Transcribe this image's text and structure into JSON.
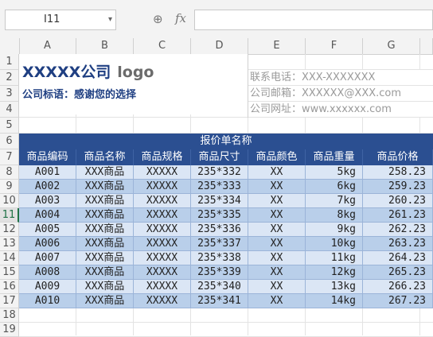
{
  "formula_bar": {
    "name_box": "I11",
    "zoom_icon": "zoom-icon",
    "fx_label": "fx",
    "formula": ""
  },
  "columns": [
    "A",
    "B",
    "C",
    "D",
    "E",
    "F",
    "G"
  ],
  "rows": [
    "1",
    "2",
    "3",
    "4",
    "5",
    "6",
    "7",
    "8",
    "9",
    "10",
    "11",
    "12",
    "13",
    "14",
    "15",
    "16",
    "17",
    "18",
    "19"
  ],
  "active_row": "11",
  "header": {
    "company_name": "XXXXX公司",
    "logo_text": "logo",
    "slogan": "公司标语：感谢您的选择",
    "phone": "联系电话：XXX-XXXXXXX",
    "email": "公司邮箱：XXXXXX@XXX.com",
    "website": "公司网址：www.xxxxxx.com"
  },
  "table": {
    "title": "报价单名称",
    "columns": [
      "商品编码",
      "商品名称",
      "商品规格",
      "商品尺寸",
      "商品颜色",
      "商品重量",
      "商品价格"
    ],
    "rows": [
      [
        "A001",
        "XXX商品",
        "XXXXX",
        "235*332",
        "XX",
        "5kg",
        "258.23"
      ],
      [
        "A002",
        "XXX商品",
        "XXXXX",
        "235*333",
        "XX",
        "6kg",
        "259.23"
      ],
      [
        "A003",
        "XXX商品",
        "XXXXX",
        "235*334",
        "XX",
        "7kg",
        "260.23"
      ],
      [
        "A004",
        "XXX商品",
        "XXXXX",
        "235*335",
        "XX",
        "8kg",
        "261.23"
      ],
      [
        "A005",
        "XXX商品",
        "XXXXX",
        "235*336",
        "XX",
        "9kg",
        "262.23"
      ],
      [
        "A006",
        "XXX商品",
        "XXXXX",
        "235*337",
        "XX",
        "10kg",
        "263.23"
      ],
      [
        "A007",
        "XXX商品",
        "XXXXX",
        "235*338",
        "XX",
        "11kg",
        "264.23"
      ],
      [
        "A008",
        "XXX商品",
        "XXXXX",
        "235*339",
        "XX",
        "12kg",
        "265.23"
      ],
      [
        "A009",
        "XXX商品",
        "XXXXX",
        "235*340",
        "XX",
        "13kg",
        "266.23"
      ],
      [
        "A010",
        "XXX商品",
        "XXXXX",
        "235*341",
        "XX",
        "14kg",
        "267.23"
      ]
    ]
  },
  "colors": {
    "header_band": "#2b4f91",
    "row_light": "#dbe6f5",
    "row_dark": "#b9cfea",
    "title_text": "#1f3f82"
  }
}
